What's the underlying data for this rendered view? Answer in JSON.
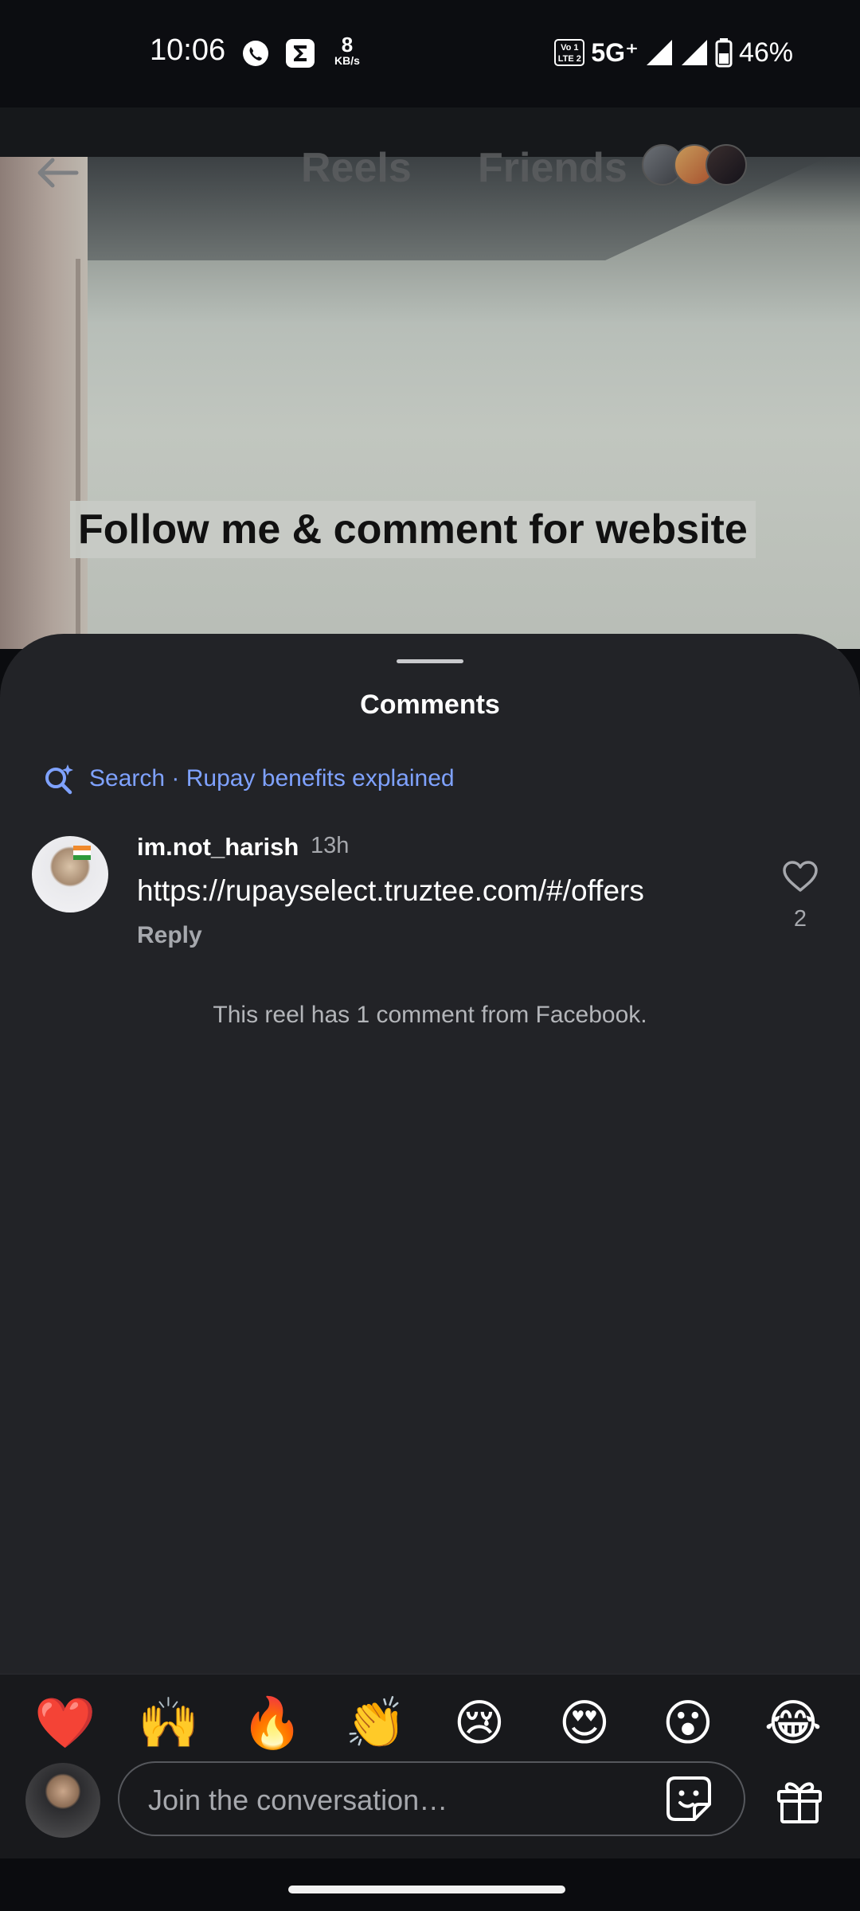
{
  "status_bar": {
    "time": "10:06",
    "speed_value": "8",
    "speed_unit": "KB/s",
    "volte_top": "Vo 1",
    "volte_bottom": "LTE 2",
    "network": "5G⁺",
    "battery": "46%",
    "icons": [
      "whatsapp-icon",
      "sigma-app-icon",
      "signal-icon",
      "signal-icon",
      "battery-icon"
    ]
  },
  "video": {
    "caption": "Follow me & comment for website"
  },
  "top_nav": {
    "tabs": [
      {
        "label": "Reels"
      },
      {
        "label": "Friends"
      }
    ],
    "icons": [
      "back-arrow-icon"
    ]
  },
  "comments_sheet": {
    "title": "Comments",
    "search_label": "Search · Rupay benefits explained",
    "comments": [
      {
        "username": "im.not_harish",
        "time": "13h",
        "text": "https://rupayselect.truztee.com/#/offers",
        "reply_label": "Reply",
        "likes": "2"
      }
    ],
    "footer_note": "This reel has 1 comment from Facebook."
  },
  "reactions": [
    "❤️",
    "🙌",
    "🔥",
    "👏",
    "😢",
    "😍",
    "😮",
    "😂"
  ],
  "composer": {
    "placeholder": "Join the conversation…",
    "icons": [
      "sticker-icon",
      "gift-icon"
    ]
  },
  "colors": {
    "sheet_background": "#222327",
    "accent_link": "#7fa2ff",
    "secondary_text": "#a6a8ad"
  }
}
